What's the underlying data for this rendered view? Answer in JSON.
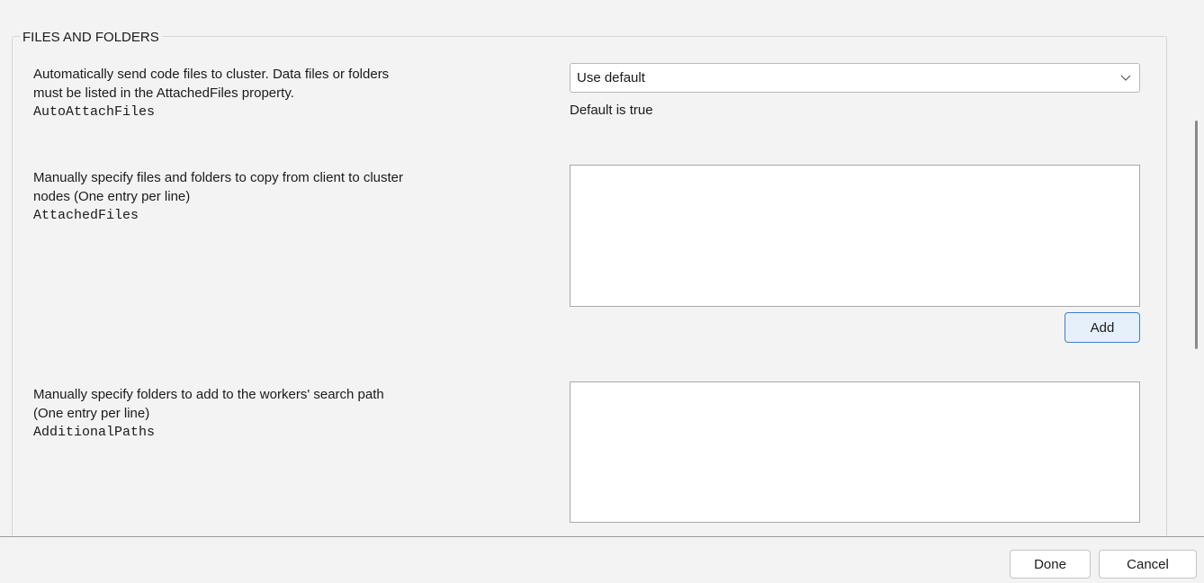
{
  "section": {
    "title": "FILES AND FOLDERS"
  },
  "auto_attach": {
    "description_lines": [
      "Automatically send code files to cluster. Data files or folders",
      "must be listed in the AttachedFiles property."
    ],
    "property": "AutoAttachFiles",
    "select_value": "Use default",
    "hint": "Default is true"
  },
  "attached_files": {
    "description_lines": [
      "Manually specify files and folders to copy from client to cluster",
      "nodes (One entry per line)"
    ],
    "property": "AttachedFiles",
    "value": "",
    "add_label": "Add"
  },
  "additional_paths": {
    "description_lines": [
      "Manually specify folders to add to the workers' search path",
      "(One entry per line)"
    ],
    "property": "AdditionalPaths",
    "value": ""
  },
  "footer": {
    "done_label": "Done",
    "cancel_label": "Cancel"
  },
  "icons": {
    "dropdown": "chevron-down-icon"
  },
  "colors": {
    "background": "#f3f3f3",
    "accent_border": "#3d7fd1",
    "accent_fill": "#e6f0fa"
  }
}
